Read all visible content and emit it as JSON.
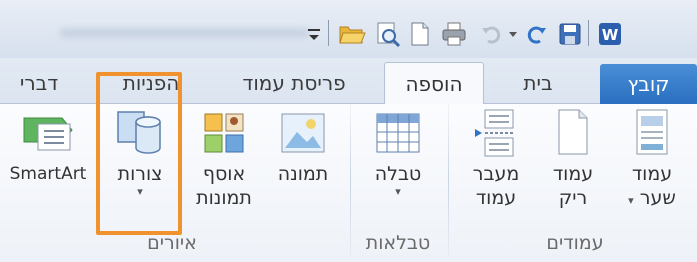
{
  "quick_access": {
    "word_icon_letter": "W",
    "items": [
      "folder-open-icon",
      "print-preview-icon",
      "new-document-icon",
      "quick-print-icon",
      "undo-icon",
      "redo-icon",
      "save-icon",
      "customize-qat-icon"
    ]
  },
  "tabs": [
    {
      "label": "קובץ",
      "state": "file"
    },
    {
      "label": "בית",
      "state": "normal"
    },
    {
      "label": "הוספה",
      "state": "active"
    },
    {
      "label": "פריסת עמוד",
      "state": "normal"
    },
    {
      "label": "הפניות",
      "state": "normal"
    },
    {
      "label": "דברי",
      "state": "normal"
    }
  ],
  "ribbon": {
    "groups": [
      {
        "label": "עמודים",
        "commands": [
          {
            "line1": "עמוד",
            "line2": "שער",
            "has_dropdown": true,
            "icon": "cover-page-icon"
          },
          {
            "line1": "עמוד",
            "line2": "ריק",
            "has_dropdown": false,
            "icon": "blank-page-icon"
          },
          {
            "line1": "מעבר",
            "line2": "עמוד",
            "has_dropdown": false,
            "icon": "page-break-icon"
          }
        ]
      },
      {
        "label": "טבלאות",
        "commands": [
          {
            "line1": "טבלה",
            "has_dropdown": true,
            "icon": "table-icon"
          }
        ]
      },
      {
        "label": "איורים",
        "commands": [
          {
            "line1": "תמונה",
            "icon": "picture-icon"
          },
          {
            "line1": "אוסף",
            "line2": "תמונות",
            "icon": "clip-art-icon"
          },
          {
            "line1": "צורות",
            "has_dropdown": true,
            "icon": "shapes-icon"
          },
          {
            "line1": "SmartArt",
            "icon": "smartart-icon"
          }
        ]
      }
    ]
  },
  "colors": {
    "highlight": "#f0932f",
    "file_tab": "#2a6fc0",
    "tab_bar": "#dbe4f0"
  }
}
